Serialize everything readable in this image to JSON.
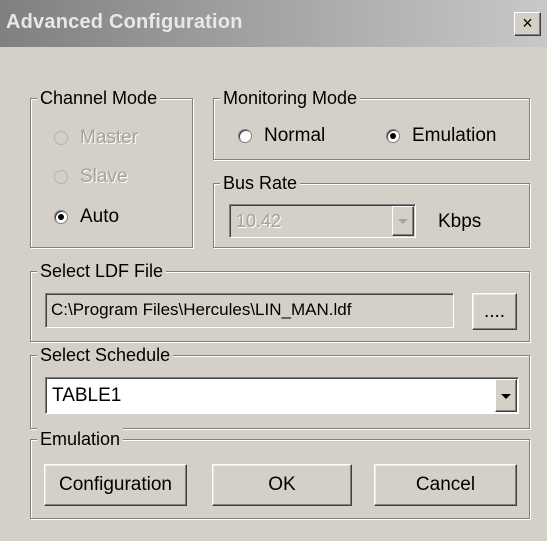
{
  "window": {
    "title": "Advanced Configuration",
    "close_label": "×"
  },
  "channel_mode": {
    "legend": "Channel Mode",
    "options": [
      {
        "label": "Master",
        "selected": false,
        "enabled": false
      },
      {
        "label": "Slave",
        "selected": false,
        "enabled": false
      },
      {
        "label": "Auto",
        "selected": true,
        "enabled": true
      }
    ]
  },
  "monitoring_mode": {
    "legend": "Monitoring Mode",
    "options": [
      {
        "label": "Normal",
        "selected": false,
        "enabled": true
      },
      {
        "label": "Emulation",
        "selected": true,
        "enabled": true
      }
    ]
  },
  "bus_rate": {
    "legend": "Bus Rate",
    "value": "10.42",
    "unit": "Kbps",
    "enabled": false
  },
  "ldf_file": {
    "legend": "Select LDF File",
    "path": "C:\\Program Files\\Hercules\\LIN_MAN.ldf",
    "browse_label": "...."
  },
  "schedule": {
    "legend": "Select Schedule",
    "value": "TABLE1"
  },
  "emulation": {
    "legend": "Emulation",
    "configuration_label": "Configuration",
    "ok_label": "OK",
    "cancel_label": "Cancel"
  }
}
